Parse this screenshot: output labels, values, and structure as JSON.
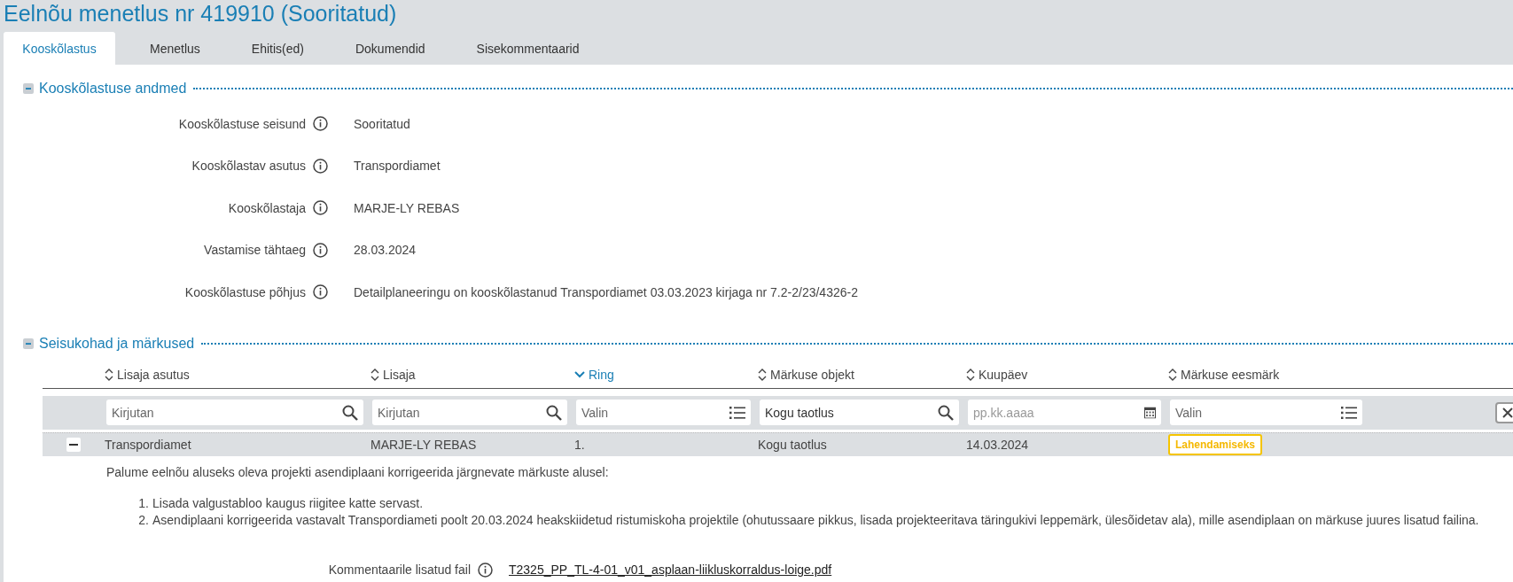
{
  "title": "Eelnõu menetlus nr 419910 (Sooritatud)",
  "tabs": [
    {
      "label": "Kooskõlastus",
      "selected": true
    },
    {
      "label": "Menetlus",
      "selected": false
    },
    {
      "label": "Ehitis(ed)",
      "selected": false
    },
    {
      "label": "Dokumendid",
      "selected": false
    },
    {
      "label": "Sisekommentaarid",
      "selected": false
    }
  ],
  "details_section": {
    "title": "Kooskõlastuse andmed",
    "expanded": true,
    "fields": [
      {
        "label": "Kooskõlastuse seisund",
        "value": "Sooritatud"
      },
      {
        "label": "Kooskõlastav asutus",
        "value": "Transpordiamet"
      },
      {
        "label": "Kooskõlastaja",
        "value": "MARJE-LY REBAS"
      },
      {
        "label": "Vastamise tähtaeg",
        "value": "28.03.2024"
      },
      {
        "label": "Kooskõlastuse põhjus",
        "value": "Detailplaneeringu on kooskõlastanud Transpordiamet 03.03.2023 kirjaga nr 7.2-2/23/4326-2"
      }
    ]
  },
  "remarks_section": {
    "title": "Seisukohad ja märkused",
    "expanded": true,
    "columns": [
      {
        "label": "Lisaja asutus",
        "sorted": false
      },
      {
        "label": "Lisaja",
        "sorted": false
      },
      {
        "label": "Ring",
        "sorted": true
      },
      {
        "label": "Märkuse objekt",
        "sorted": false
      },
      {
        "label": "Kuupäev",
        "sorted": false
      },
      {
        "label": "Märkuse eesmärk",
        "sorted": false
      }
    ],
    "filters": [
      {
        "kind": "search",
        "placeholder": "Kirjutan"
      },
      {
        "kind": "search",
        "placeholder": "Kirjutan"
      },
      {
        "kind": "select",
        "placeholder": "Valin"
      },
      {
        "kind": "search",
        "value": "Kogu taotlus"
      },
      {
        "kind": "date",
        "placeholder": "pp.kk.aaaa"
      },
      {
        "kind": "select",
        "placeholder": "Valin"
      }
    ],
    "rows": [
      {
        "expanded": true,
        "cells": [
          "Transpordiamet",
          "MARJE-LY REBAS",
          "1.",
          "Kogu taotlus",
          "14.03.2024"
        ],
        "purpose": "Lahendamiseks",
        "comment": {
          "intro": "Palume eelnõu aluseks oleva projekti asendiplaani korrigeerida järgnevate märkuste alusel:",
          "items": [
            {
              "number": "1.",
              "text": "Lisada valgustabloo kaugus riigitee katte servast."
            },
            {
              "number": "2.",
              "text": "Asendiplaani korrigeerida vastavalt Transpordiameti poolt 20.03.2024 heakskiidetud ristumiskoha projektile (ohutussaare pikkus, lisada projekteeritava täringukivi leppemärk, ülesõidetav ala), mille asendiplaan on märkuse juures lisatud failina."
            }
          ]
        },
        "attachment": {
          "label": "Kommentaarile lisatud fail",
          "file": "T2325_PP_TL-4-01_v01_asplaan-liikluskorraldus-loige.pdf"
        }
      }
    ]
  }
}
